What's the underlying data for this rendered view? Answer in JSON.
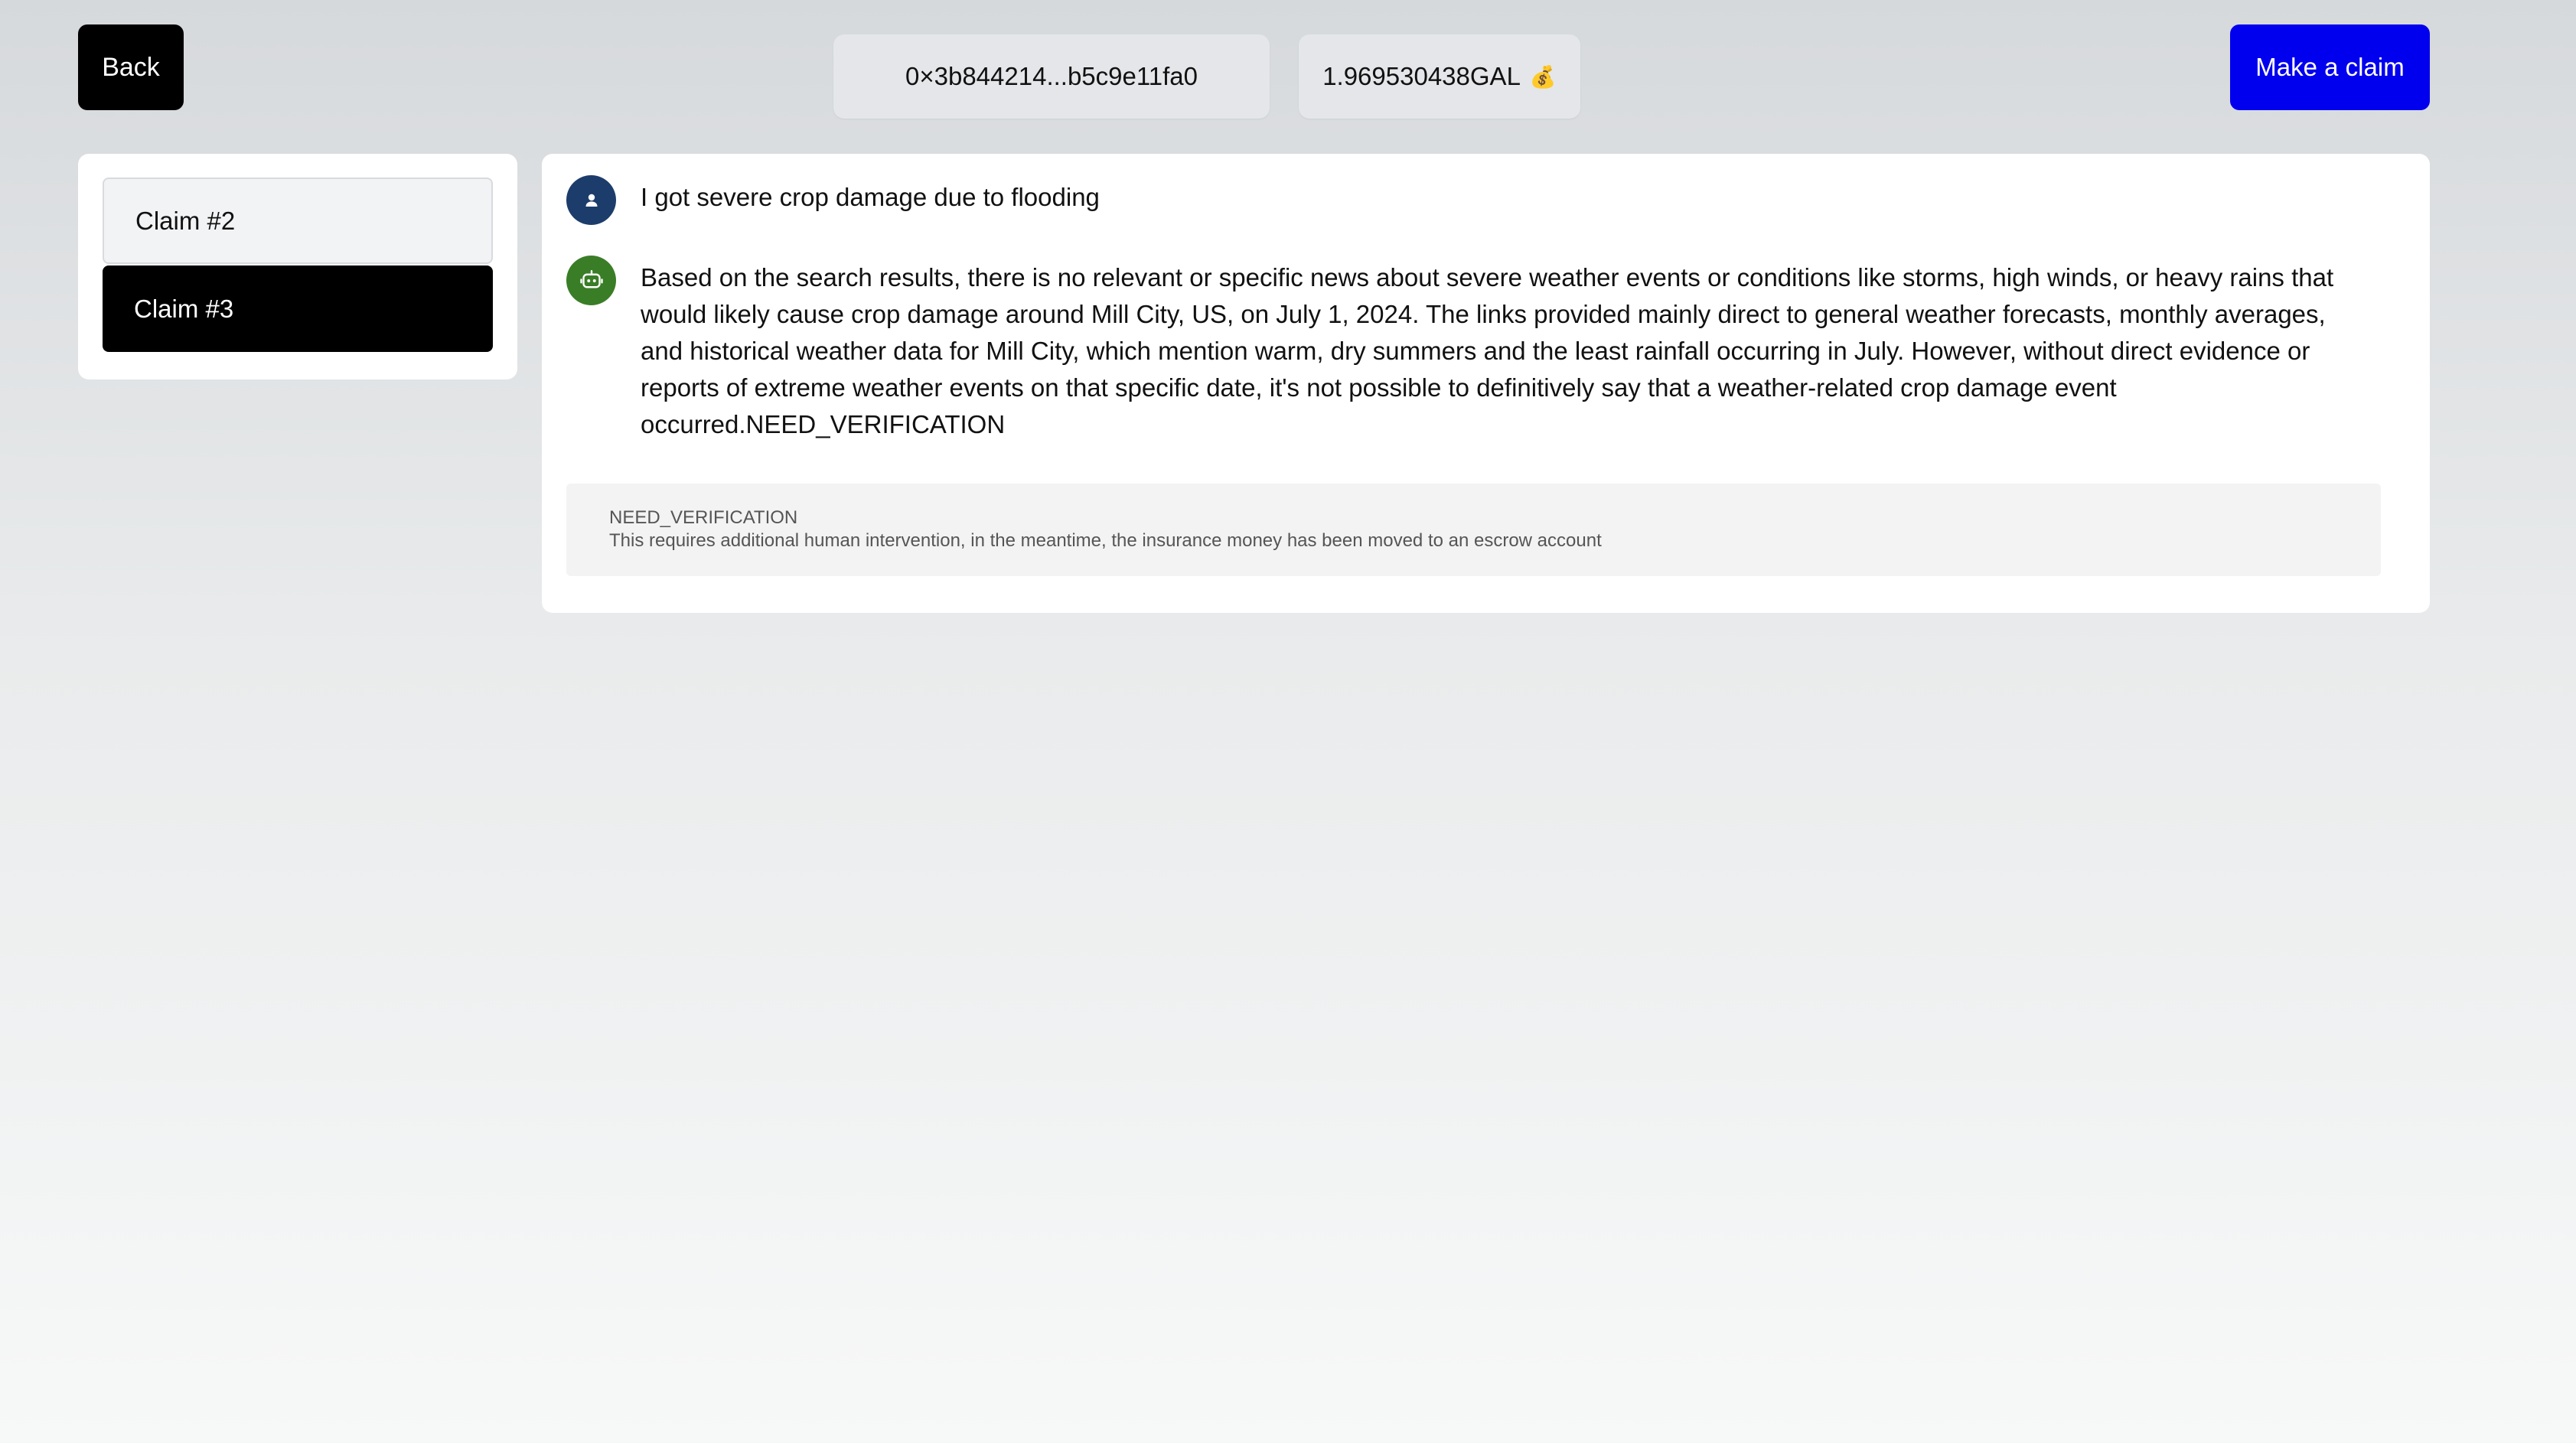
{
  "header": {
    "back_label": "Back",
    "wallet_address": "0×3b844214...b5c9e11fa0",
    "balance": "1.969530438GAL",
    "balance_icon": "money-bag-icon",
    "make_claim_label": "Make a claim",
    "accent_color": "#0000ee"
  },
  "sidebar": {
    "claims": [
      {
        "label": "Claim #2",
        "active": false
      },
      {
        "label": "Claim #3",
        "active": true
      }
    ]
  },
  "chat": {
    "messages": [
      {
        "role": "user",
        "icon": "user-icon",
        "text": "I got severe crop damage due to flooding"
      },
      {
        "role": "bot",
        "icon": "robot-icon",
        "lines": [
          "Based on the search results, there is no relevant or specific news about severe weather events or conditions like storms, high winds, or heavy rains that",
          "would likely cause crop damage around Mill City, US, on July 1, 2024. The links provided mainly direct to general weather forecasts, monthly averages,",
          "and historical weather data for Mill City, which mention warm, dry summers and the least rainfall occurring in July. However, without direct evidence or",
          "reports of extreme weather events on that specific date, it's not possible to definitively say that a weather-related crop damage event",
          "occurred.NEED_VERIFICATION"
        ]
      }
    ],
    "notice": {
      "title": "NEED_VERIFICATION",
      "description": "This requires additional human intervention, in the meantime, the insurance money has been moved to an escrow account"
    }
  }
}
